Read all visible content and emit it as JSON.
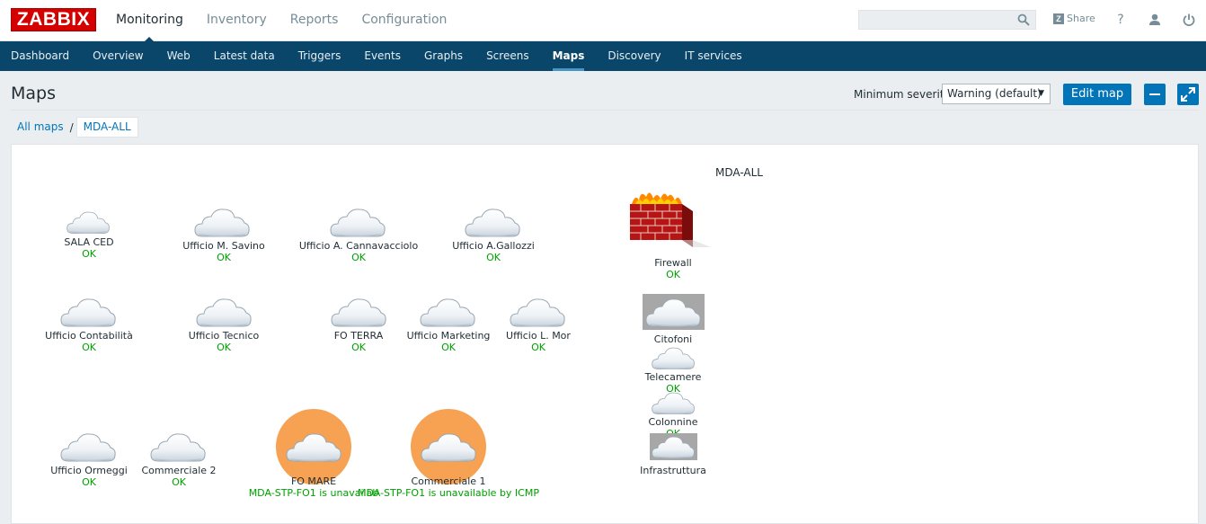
{
  "header": {
    "logo": "ZABBIX",
    "nav": [
      "Monitoring",
      "Inventory",
      "Reports",
      "Configuration"
    ],
    "active_nav": "Monitoring",
    "search_value": "",
    "share_label": "Share",
    "help_symbol": "?"
  },
  "subnav": [
    "Dashboard",
    "Overview",
    "Web",
    "Latest data",
    "Triggers",
    "Events",
    "Graphs",
    "Screens",
    "Maps",
    "Discovery",
    "IT services"
  ],
  "active_subnav": "Maps",
  "page": {
    "title": "Maps",
    "severity_label": "Minimum severity",
    "severity_value": "Warning (default)",
    "edit_button": "Edit map"
  },
  "breadcrumbs": [
    "All maps",
    "MDA-ALL"
  ],
  "map": {
    "title": "MDA-ALL",
    "nodes": [
      {
        "label": "SALA CED",
        "status": "OK"
      },
      {
        "label": "Ufficio M. Savino",
        "status": "OK"
      },
      {
        "label": "Ufficio A. Cannavacciolo",
        "status": "OK"
      },
      {
        "label": "Ufficio A.Gallozzi",
        "status": "OK"
      },
      {
        "label": "Firewall",
        "status": "OK"
      },
      {
        "label": "Ufficio Contabilità",
        "status": "OK"
      },
      {
        "label": "Ufficio Tecnico",
        "status": "OK"
      },
      {
        "label": "FO TERRA",
        "status": "OK"
      },
      {
        "label": "Ufficio Marketing",
        "status": "OK"
      },
      {
        "label": "Ufficio L. Mor",
        "status": "OK"
      },
      {
        "label": "Citofoni",
        "status": ""
      },
      {
        "label": "Telecamere",
        "status": "OK"
      },
      {
        "label": "Colonnine",
        "status": "OK"
      },
      {
        "label": "Infrastruttura",
        "status": ""
      },
      {
        "label": "Ufficio Ormeggi",
        "status": "OK"
      },
      {
        "label": "Commerciale 2",
        "status": "OK"
      },
      {
        "label": "FO MARE",
        "status": "MDA-STP-FO1 is unavailab"
      },
      {
        "label": "Commerciale 1",
        "status": "MDA-STP-FO1 is unavailable by ICMP"
      }
    ]
  },
  "colors": {
    "header_bg": "#0a466a",
    "accent": "#0275b8",
    "ok": "#00a000",
    "problem": "#9f0000",
    "problem_halo": "#f7a153",
    "logo_red": "#d40000"
  },
  "icons": [
    "search-icon",
    "share-icon",
    "help-icon",
    "user-icon",
    "power-icon",
    "minimize-icon",
    "fullscreen-icon",
    "cloud-icon",
    "firewall-icon"
  ]
}
